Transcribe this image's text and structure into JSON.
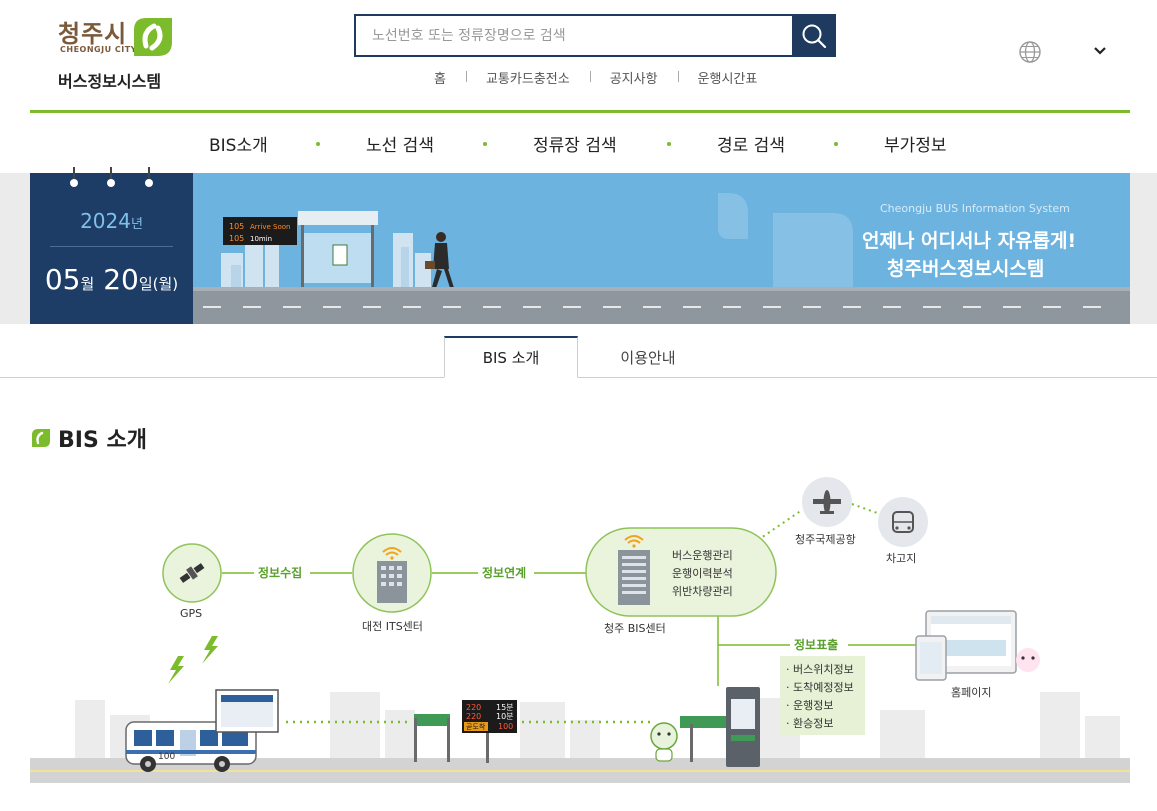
{
  "header": {
    "logo_city": "청주시",
    "logo_city_en": "CHEONGJU CITY",
    "logo_system": "버스정보시스템",
    "search_placeholder": "노선번호 또는 정류장명으로 검색",
    "quick_links": [
      "홈",
      "교통카드충전소",
      "공지사항",
      "운행시간표"
    ]
  },
  "nav": {
    "items": [
      "BIS소개",
      "노선 검색",
      "정류장 검색",
      "경로 검색",
      "부가정보"
    ]
  },
  "banner": {
    "year": "2024",
    "year_unit": "년",
    "month": "05",
    "month_unit": "월",
    "day": "20",
    "day_unit": "일(월)",
    "subtitle": "Cheongju BUS Information System",
    "title_line1": "언제나 어디서나 자유롭게!",
    "title_line2": "청주버스정보시스템",
    "display_row1_route": "105",
    "display_row1_msg": "Arrive Soon",
    "display_row2_route": "105",
    "display_row2_msg": "10min"
  },
  "tabs": [
    "BIS 소개",
    "이용안내"
  ],
  "section": {
    "title": "BIS 소개"
  },
  "diagram": {
    "gps": "GPS",
    "collect": "정보수집",
    "its_center": "대전 ITS센터",
    "link": "정보연계",
    "bis_center": "청주 BIS센터",
    "bis_functions": [
      "버스운행관리",
      "운행이력분석",
      "위반차량관리"
    ],
    "airport": "청주국제공항",
    "garage": "차고지",
    "display": "정보표출",
    "display_items": [
      "버스위치정보",
      "도착예정정보",
      "운행정보",
      "환승정보"
    ],
    "homepage": "홈페이지",
    "bus_number": "100",
    "sign_rows": [
      {
        "route": "220",
        "time": "15분"
      },
      {
        "route": "220",
        "time": "10분"
      },
      {
        "route": "곧도착",
        "time": "100"
      }
    ]
  },
  "colors": {
    "navy": "#1d3d66",
    "green": "#7cbb2c",
    "banner_sky": "#6db3e0"
  }
}
